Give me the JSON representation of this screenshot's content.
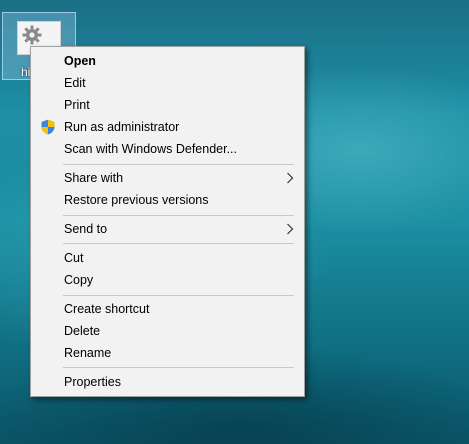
{
  "desktop": {
    "icon_label": "hi"
  },
  "context_menu": {
    "items": [
      {
        "label": "Open"
      },
      {
        "label": "Edit"
      },
      {
        "label": "Print"
      },
      {
        "label": "Run as administrator",
        "icon": "uac-shield-icon"
      },
      {
        "label": "Scan with Windows Defender..."
      },
      {
        "label": "Share with",
        "submenu": true
      },
      {
        "label": "Restore previous versions"
      },
      {
        "label": "Send to",
        "submenu": true
      },
      {
        "label": "Cut"
      },
      {
        "label": "Copy"
      },
      {
        "label": "Create shortcut"
      },
      {
        "label": "Delete"
      },
      {
        "label": "Rename"
      },
      {
        "label": "Properties"
      }
    ]
  },
  "colors": {
    "menu_background": "#f2f2f2",
    "menu_border": "#a0a0a0",
    "separator": "#cacaca",
    "desktop_teal": "#1c8fa2"
  }
}
